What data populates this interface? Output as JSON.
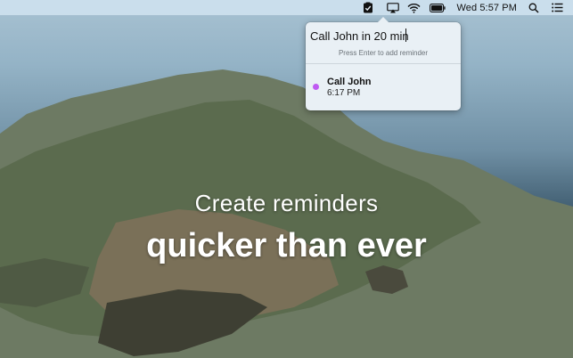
{
  "menubar": {
    "clock": "Wed 5:57 PM",
    "icons": [
      "reminders-icon",
      "airplay-icon",
      "wifi-icon",
      "battery-icon",
      "search-icon",
      "list-icon"
    ]
  },
  "popover": {
    "input_value": "Call John in 20 min",
    "hint": "Press Enter to add reminder",
    "reminder": {
      "title": "Call John",
      "time": "6:17 PM",
      "dot_color": "#bf5af2"
    }
  },
  "headline": {
    "line1": "Create reminders",
    "line2": "quicker than ever"
  }
}
